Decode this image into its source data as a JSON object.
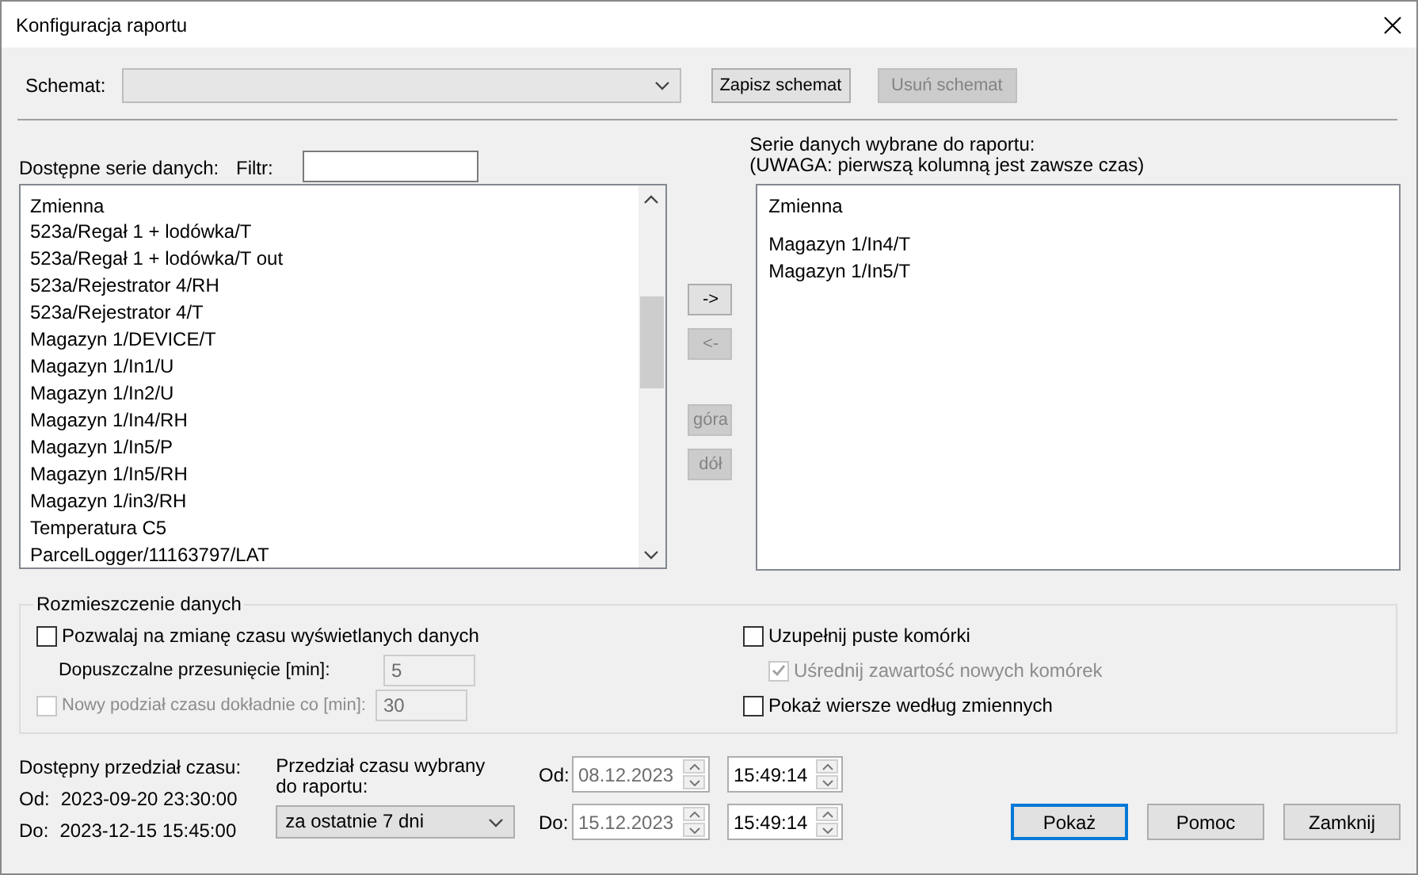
{
  "window": {
    "title": "Konfiguracja raportu"
  },
  "schema": {
    "label": "Schemat:",
    "buttons": [
      {
        "label": "Zapisz schemat",
        "disabled": false
      },
      {
        "label": "Usuń schemat",
        "disabled": true
      }
    ]
  },
  "available": {
    "label": "Dostępne serie danych:",
    "filter_label": "Filtr:",
    "header": "Zmienna",
    "items": [
      "523a/Regał 1 + lodówka/T",
      "523a/Regał 1 + lodówka/T out",
      "523a/Rejestrator 4/RH",
      "523a/Rejestrator 4/T",
      "Magazyn 1/DEVICE/T",
      "Magazyn 1/In1/U",
      "Magazyn 1/In2/U",
      "Magazyn 1/In4/RH",
      "Magazyn 1/In5/P",
      "Magazyn 1/In5/RH",
      "Magazyn 1/in3/RH",
      "Temperatura C5",
      "ParcelLogger/11163797/LAT"
    ]
  },
  "transfer_buttons": [
    {
      "label": "->",
      "disabled": false
    },
    {
      "label": "<-",
      "disabled": true
    },
    {
      "label": "góra",
      "disabled": true
    },
    {
      "label": "dół",
      "disabled": true
    }
  ],
  "selected": {
    "label": "Serie danych wybrane do raportu:",
    "note": "(UWAGA: pierwszą kolumną jest zawsze czas)",
    "header": "Zmienna",
    "items": [
      "Magazyn 1/In4/T",
      "Magazyn 1/In5/T"
    ]
  },
  "layout_group": {
    "title": "Rozmieszczenie danych",
    "left": [
      {
        "kind": "checkbox",
        "label": "Pozwalaj na zmianę czasu wyświetlanych danych",
        "checked": false,
        "disabled": false
      },
      {
        "kind": "field",
        "label": "Dopuszczalne przesunięcie [min]:",
        "value": "5",
        "disabled": true
      },
      {
        "kind": "checkbox_field",
        "label": "Nowy podział czasu dokładnie co [min]:",
        "checked": false,
        "disabled": true,
        "value": "30"
      }
    ],
    "right": [
      {
        "kind": "checkbox",
        "label": "Uzupełnij puste komórki",
        "checked": false,
        "disabled": false
      },
      {
        "kind": "sub_checkbox",
        "label": "Uśrednij zawartość nowych komórek",
        "checked": true,
        "disabled": true
      },
      {
        "kind": "checkbox",
        "label": "Pokaż wiersze według zmiennych",
        "checked": false,
        "disabled": false
      }
    ]
  },
  "available_range": {
    "title": "Dostępny przedział czasu:",
    "rows": [
      {
        "label": "Od:",
        "value": "2023-09-20 23:30:00"
      },
      {
        "label": "Do:",
        "value": "2023-12-15 15:45:00"
      }
    ]
  },
  "report_range": {
    "title_lines": [
      "Przedział czasu wybrany",
      "do raportu:"
    ],
    "value": "za ostatnie 7 dni"
  },
  "date_rows": [
    {
      "label": "Od:",
      "date": "08.12.2023",
      "time": "15:49:14"
    },
    {
      "label": "Do:",
      "date": "15.12.2023",
      "time": "15:49:14"
    }
  ],
  "buttons": [
    {
      "label": "Pokaż",
      "default": true
    },
    {
      "label": "Pomoc",
      "default": false
    },
    {
      "label": "Zamknij",
      "default": false
    }
  ]
}
